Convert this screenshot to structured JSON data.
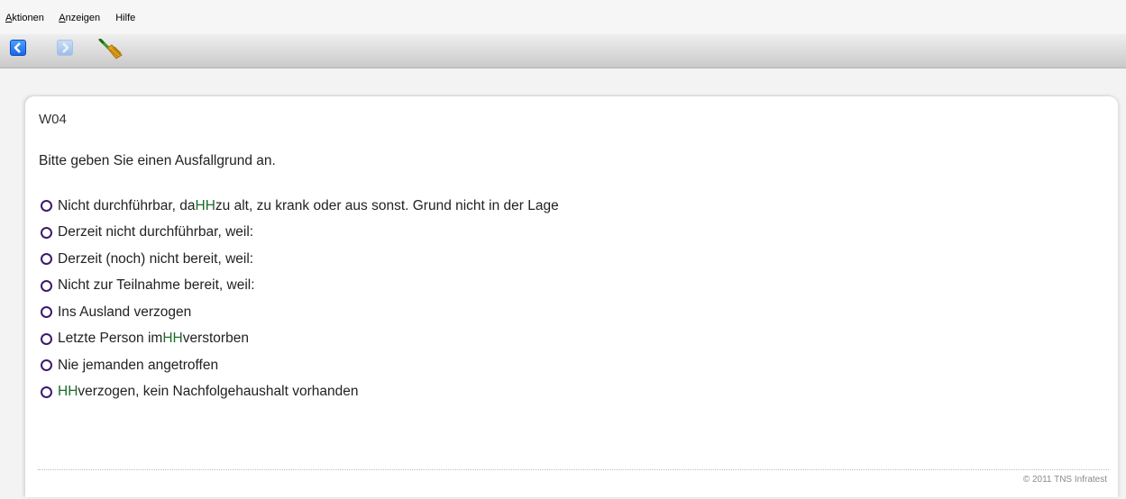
{
  "menu": {
    "items": [
      {
        "label": "Aktionen",
        "accel": "A",
        "rest": "ktionen"
      },
      {
        "label": "Anzeigen",
        "accel": "A",
        "rest": "nzeigen"
      },
      {
        "label": "Hilfe",
        "accel": "",
        "rest": "Hilfe"
      }
    ]
  },
  "toolbar": {
    "back_icon": "chevron-left-icon",
    "forward_icon": "chevron-right-icon",
    "clear_icon": "broom-icon"
  },
  "question": {
    "id": "W04",
    "text": "Bitte geben Sie einen Ausfallgrund an.",
    "options": [
      {
        "pre": "Nicht durchführbar, da ",
        "hh": "HH",
        "post": " zu alt, zu krank oder aus sonst. Grund nicht in der Lage"
      },
      {
        "pre": "Derzeit nicht durchführbar, weil:",
        "hh": "",
        "post": ""
      },
      {
        "pre": "Derzeit (noch) nicht bereit, weil:",
        "hh": "",
        "post": ""
      },
      {
        "pre": "Nicht zur Teilnahme bereit, weil:",
        "hh": "",
        "post": ""
      },
      {
        "pre": "Ins Ausland verzogen",
        "hh": "",
        "post": ""
      },
      {
        "pre": "Letzte Person im ",
        "hh": "HH",
        "post": " verstorben"
      },
      {
        "pre": "Nie jemanden angetroffen",
        "hh": "",
        "post": ""
      },
      {
        "pre": "",
        "hh": "HH",
        "post": " verzogen, kein Nachfolgehaushalt vorhanden"
      }
    ]
  },
  "footer": {
    "copyright": "© 2011 TNS Infratest"
  },
  "colors": {
    "radio_border": "#3c1a6e",
    "hh_highlight": "#1e6b2a",
    "back_button": "#1a66e8"
  }
}
